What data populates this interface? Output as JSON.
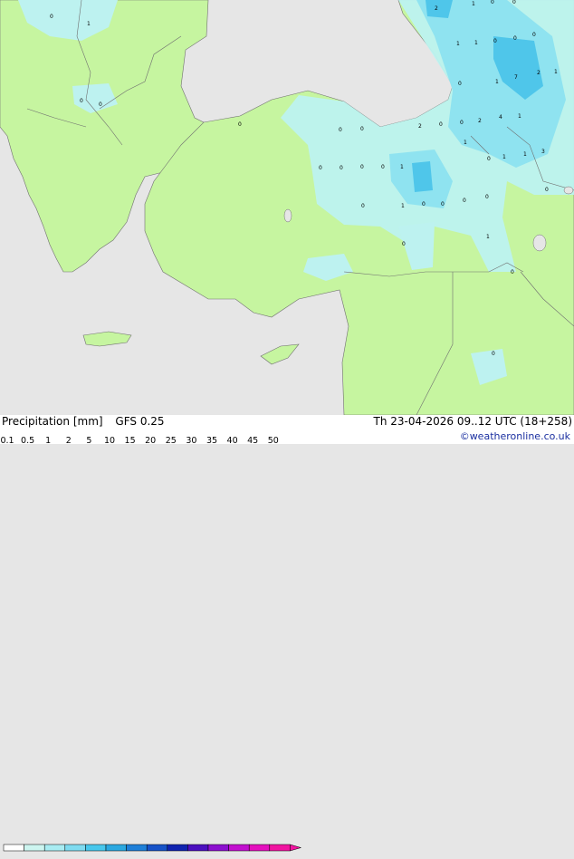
{
  "title": "Precipitation [mm]",
  "model": "GFS 0.25",
  "datetime": "Th 23-04-2026 09..12 UTC (18+258)",
  "credit": "©weatheronline.co.uk",
  "legend": {
    "labels": [
      "0.1",
      "0.5",
      "1",
      "2",
      "5",
      "10",
      "15",
      "20",
      "25",
      "30",
      "35",
      "40",
      "45",
      "50"
    ],
    "colors": [
      "#ffffff",
      "#cdf5f0",
      "#a9ecf2",
      "#7fdbf0",
      "#47c7ec",
      "#2ba8e0",
      "#1e7fd8",
      "#1652c8",
      "#0f23b0",
      "#4b0fbf",
      "#8c0fcf",
      "#c20fcf",
      "#e40fbe",
      "#f014a0"
    ]
  },
  "map_colors": {
    "sea": "#e6e6e6",
    "land": "#c6f5a0",
    "precip_light": "#bdf2f0",
    "precip_mid": "#8fe3f0",
    "precip_heavy": "#4fc6ea",
    "border": "#707070"
  },
  "precip_values": [
    "0",
    "2",
    "1",
    "0",
    "0",
    "1",
    "1",
    "0",
    "0",
    "0",
    "0",
    "1",
    "7",
    "2",
    "1",
    "0",
    "0",
    "1",
    "0",
    "2",
    "4",
    "1",
    "0",
    "0",
    "0",
    "0",
    "1",
    "2",
    "0",
    "0",
    "1",
    "1",
    "3",
    "0",
    "0",
    "1",
    "0",
    "0",
    "0",
    "1",
    "0",
    "0",
    "0",
    "0",
    "0",
    "1",
    "0",
    "0"
  ]
}
